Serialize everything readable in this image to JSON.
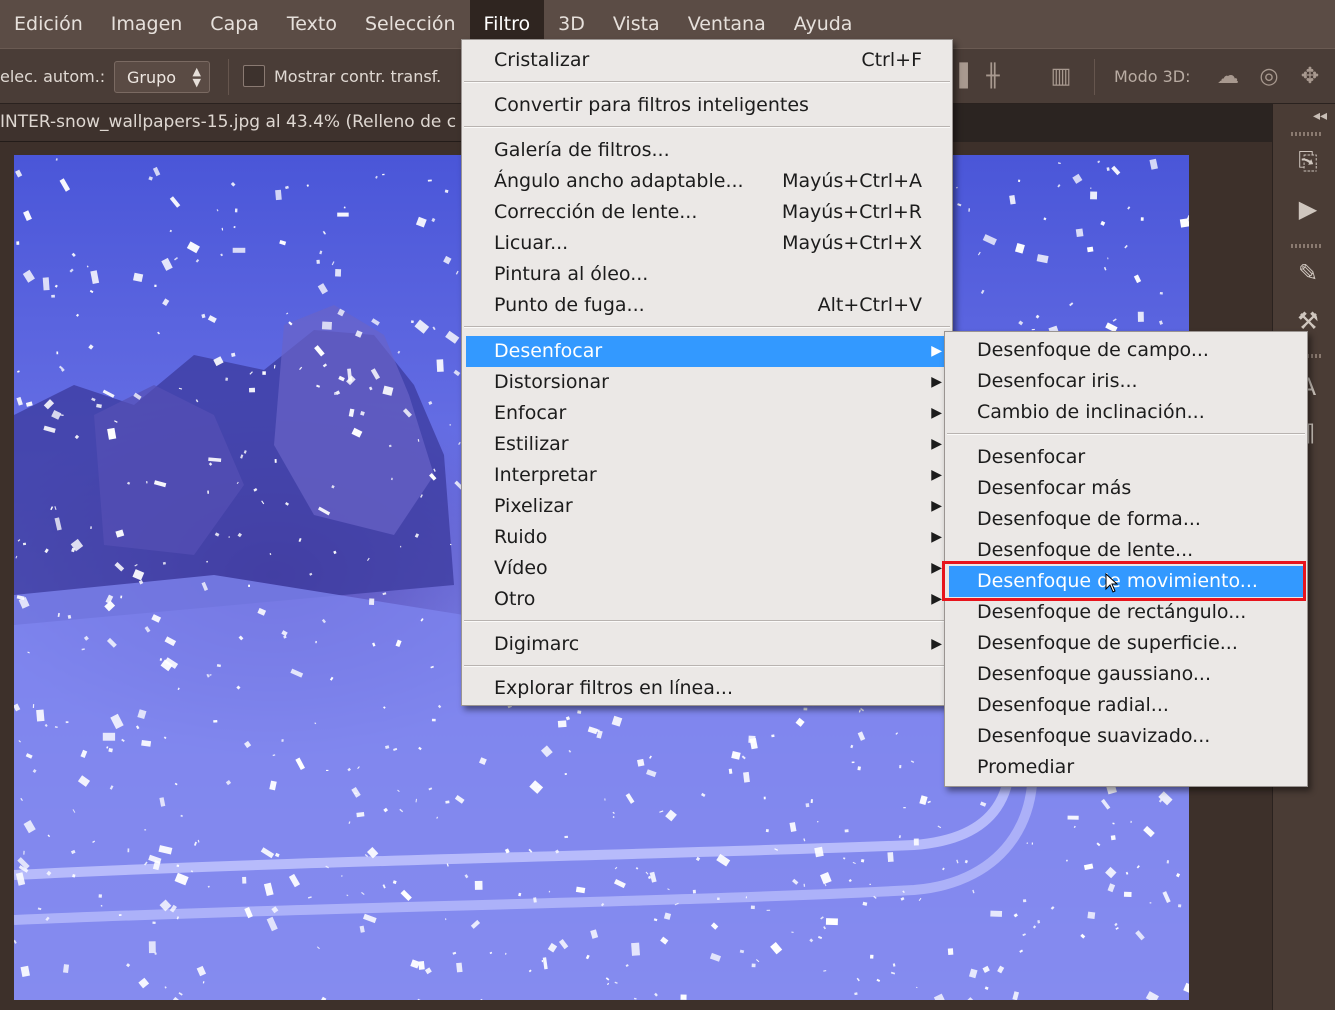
{
  "menubar": {
    "items": [
      {
        "label": "Edición"
      },
      {
        "label": "Imagen"
      },
      {
        "label": "Capa"
      },
      {
        "label": "Texto"
      },
      {
        "label": "Selección"
      },
      {
        "label": "Filtro",
        "active": true
      },
      {
        "label": "3D"
      },
      {
        "label": "Vista"
      },
      {
        "label": "Ventana"
      },
      {
        "label": "Ayuda"
      }
    ]
  },
  "options": {
    "auto_select_label": "elec. autom.:",
    "group_select": "Grupo",
    "show_transform_label": "Mostrar contr. transf.",
    "mode_3d_label": "Modo 3D:"
  },
  "document": {
    "tab_title": "INTER-snow_wallpapers-15.jpg al 43.4% (Relleno de c"
  },
  "filter_menu": {
    "top_items": [
      {
        "label": "Cristalizar",
        "shortcut": "Ctrl+F"
      },
      {
        "label": "Convertir para filtros inteligentes",
        "shortcut": ""
      }
    ],
    "gallery_items": [
      {
        "label": "Galería de filtros...",
        "shortcut": ""
      },
      {
        "label": "Ángulo ancho adaptable...",
        "shortcut": "Mayús+Ctrl+A"
      },
      {
        "label": "Corrección de lente...",
        "shortcut": "Mayús+Ctrl+R"
      },
      {
        "label": "Licuar...",
        "shortcut": "Mayús+Ctrl+X"
      },
      {
        "label": "Pintura al óleo...",
        "shortcut": ""
      },
      {
        "label": "Punto de fuga...",
        "shortcut": "Alt+Ctrl+V"
      }
    ],
    "submenus": [
      {
        "label": "Desenfocar",
        "highlighted": true
      },
      {
        "label": "Distorsionar"
      },
      {
        "label": "Enfocar"
      },
      {
        "label": "Estilizar"
      },
      {
        "label": "Interpretar"
      },
      {
        "label": "Pixelizar"
      },
      {
        "label": "Ruido"
      },
      {
        "label": "Vídeo"
      },
      {
        "label": "Otro"
      }
    ],
    "digimarc": "Digimarc",
    "browse_online": "Explorar filtros en línea..."
  },
  "blur_submenu": {
    "gallery": [
      {
        "label": "Desenfoque de campo..."
      },
      {
        "label": "Desenfocar iris..."
      },
      {
        "label": "Cambio de inclinación..."
      }
    ],
    "items": [
      {
        "label": "Desenfocar"
      },
      {
        "label": "Desenfocar más"
      },
      {
        "label": "Desenfoque de forma..."
      },
      {
        "label": "Desenfoque de lente..."
      },
      {
        "label": "Desenfoque de movimiento...",
        "highlighted": true
      },
      {
        "label": "Desenfoque de rectángulo..."
      },
      {
        "label": "Desenfoque de superficie..."
      },
      {
        "label": "Desenfoque gaussiano..."
      },
      {
        "label": "Desenfoque radial..."
      },
      {
        "label": "Desenfoque suavizado..."
      },
      {
        "label": "Promediar"
      }
    ]
  },
  "colors": {
    "highlight": "#3399ff",
    "callout_border": "#e8141c",
    "menubar_bg": "#5b4c45"
  }
}
